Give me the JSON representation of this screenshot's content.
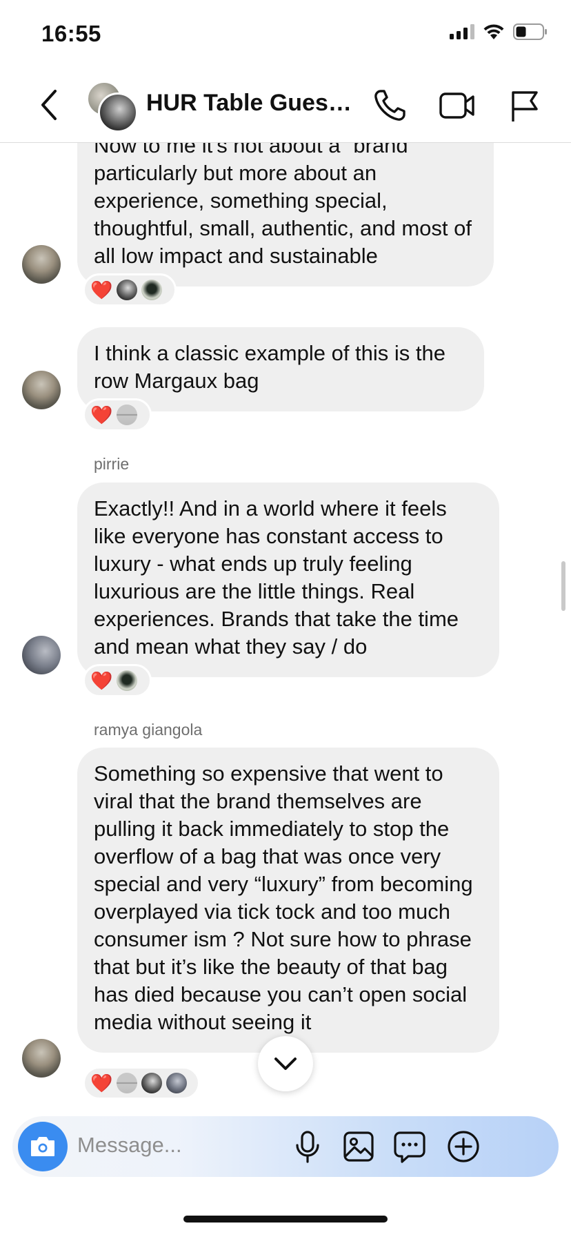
{
  "status_bar": {
    "time": "16:55"
  },
  "header": {
    "title": "HUR Table Guest..."
  },
  "messages": [
    {
      "id": "m1",
      "text": "Now to me it's not about a “brand” particularly but more about an experience, something special, thoughtful, small, authentic, and most of all low impact and sustainable",
      "reactions": [
        "❤️",
        "dark-avatar",
        "green-avatar"
      ]
    },
    {
      "id": "m2",
      "text": "I think a classic example of this is the row Margaux bag",
      "reactions": [
        "❤️",
        "grey-avatar"
      ]
    },
    {
      "id": "m3",
      "sender": "pirrie",
      "text": "Exactly!! And in a world where it feels like everyone has constant access to luxury - what ends up truly feeling luxurious are the little things. Real experiences. Brands that take the time and mean what they say / do",
      "reactions": [
        "❤️",
        "green-avatar"
      ]
    },
    {
      "id": "m4",
      "sender": "ramya giangola",
      "text": "Something so expensive that went to viral that the brand themselves are pulling it back immediately to stop the overflow of a bag that was once very special and very “luxury” from becoming overplayed via tick tock and too much consumer ism ? Not sure how to phrase that but it’s like the beauty of that bag has died because you can’t open social media without seeing it",
      "reactions": [
        "❤️",
        "grey-avatar",
        "dark-avatar",
        "blue-avatar"
      ]
    }
  ],
  "composer": {
    "placeholder": "Message..."
  },
  "colors": {
    "bubble": "#efefef",
    "accent_blue": "#3a8cf0",
    "heart": "#e21b3c"
  },
  "icons": [
    "back-chevron-icon",
    "phone-icon",
    "video-icon",
    "flag-icon",
    "camera-icon",
    "microphone-icon",
    "image-icon",
    "sticker-icon",
    "plus-icon",
    "chevron-down-icon"
  ]
}
